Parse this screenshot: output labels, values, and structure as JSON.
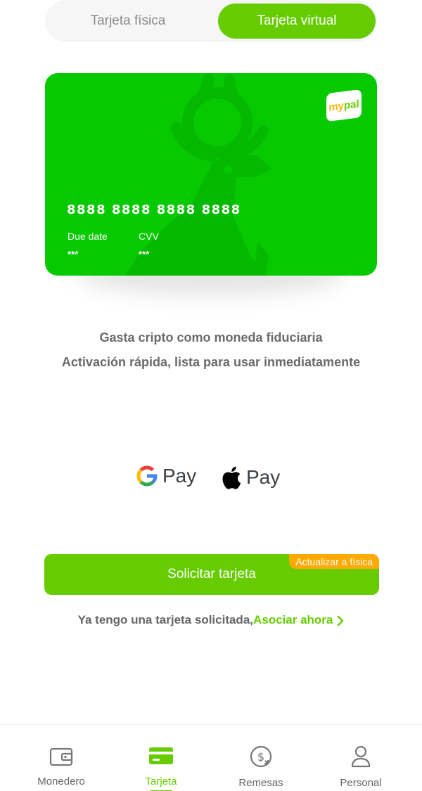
{
  "tabs": [
    {
      "label": "Tarjeta física",
      "active": false
    },
    {
      "label": "Tarjeta virtual",
      "active": true
    }
  ],
  "card": {
    "brand_my": "my",
    "brand_pal": "pal",
    "number": "8888 8888 8888 8888",
    "due_date_label": "Due date",
    "due_date_value": "***",
    "cvv_label": "CVV",
    "cvv_value": "***",
    "color": "#06c900"
  },
  "taglines": {
    "line1": "Gasta cripto como moneda fiduciaria",
    "line2": "Activación rápida, lista para usar inmediatamente"
  },
  "payment_methods": {
    "google_pay": "Pay",
    "apple_pay": "Pay"
  },
  "request": {
    "button_label": "Solicitar tarjeta",
    "badge": "Actualizar a física"
  },
  "associate": {
    "text": "Ya tengo una tarjeta solicitada,",
    "link": "Asociar ahora"
  },
  "nav": {
    "items": [
      {
        "label": "Monedero",
        "icon": "wallet-icon",
        "active": false
      },
      {
        "label": "Tarjeta",
        "icon": "card-icon",
        "active": true
      },
      {
        "label": "Remesas",
        "icon": "dollar-exchange-icon",
        "active": false
      },
      {
        "label": "Personal",
        "icon": "person-icon",
        "active": false
      }
    ]
  },
  "colors": {
    "accent": "#66cc00",
    "badge": "#ffaa00"
  }
}
